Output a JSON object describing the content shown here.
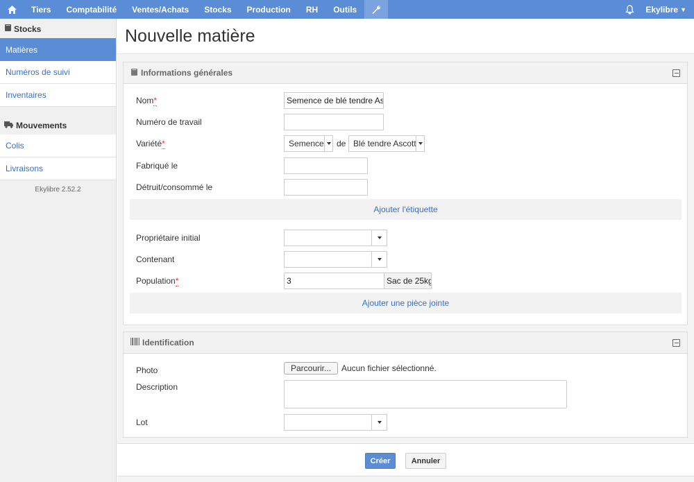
{
  "nav": {
    "home_icon": "home-icon",
    "items": [
      "Tiers",
      "Comptabilité",
      "Ventes/Achats",
      "Stocks",
      "Production",
      "RH",
      "Outils"
    ],
    "tools_icon": "wrench-icon",
    "bell_icon": "bell-icon",
    "user": "Ekylibre",
    "accent": "#5b8dd6"
  },
  "sidebar": {
    "section1": "Stocks",
    "section1_items": [
      "Matières",
      "Numéros de suivi",
      "Inventaires"
    ],
    "section2": "Mouvements",
    "section2_items": [
      "Colis",
      "Livraisons"
    ],
    "version": "Ekylibre 2.52.2",
    "active": "Matières"
  },
  "page": {
    "title": "Nouvelle matière"
  },
  "general": {
    "title": "Informations générales",
    "nom_label": "Nom",
    "nom_value": "Semence de blé tendre Ascott",
    "numero_label": "Numéro de travail",
    "numero_value": "",
    "variete_label": "Variété",
    "variete_type": "Semence",
    "variete_de": "de",
    "variete_value": "Blé tendre Ascott",
    "fabrique_label": "Fabriqué le",
    "detruit_label": "Détruit/consommé le",
    "add_label": "Ajouter l'étiquette",
    "proprietaire_label": "Propriétaire initial",
    "contenant_label": "Contenant",
    "population_label": "Population",
    "population_value": "3",
    "population_unit": "Sac de 25kg",
    "add_attachment": "Ajouter une pièce jointe"
  },
  "identification": {
    "title": "Identification",
    "photo_label": "Photo",
    "browse_label": "Parcourir...",
    "no_file": "Aucun fichier sélectionné.",
    "description_label": "Description",
    "lot_label": "Lot"
  },
  "actions": {
    "create": "Créer",
    "cancel": "Annuler"
  }
}
